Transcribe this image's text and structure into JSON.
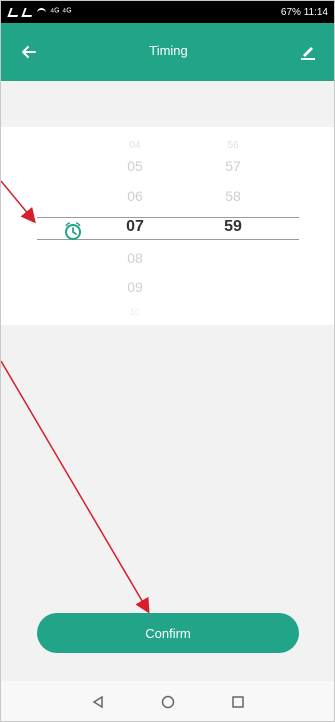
{
  "status": {
    "left": "⁴ᴳ ⁴ᴳ",
    "right": "67% 11:14"
  },
  "header": {
    "title": "Timing"
  },
  "picker": {
    "hour": {
      "upper_far": "04",
      "upper_2": "05",
      "upper_1": "06",
      "selected": "07",
      "lower_1": "08",
      "lower_2": "09",
      "lower_far": "10"
    },
    "minute": {
      "upper_far": "56",
      "upper_2": "57",
      "upper_1": "58",
      "selected": "59"
    }
  },
  "actions": {
    "confirm_label": "Confirm"
  },
  "icons": {
    "back": "arrow-left-icon",
    "edit": "pencil-icon",
    "alarm": "alarm-clock-icon",
    "nav_back": "triangle-back-icon",
    "nav_home": "circle-home-icon",
    "nav_recent": "square-recent-icon"
  },
  "colors": {
    "primary": "#21a487",
    "annotation": "#d61f2b"
  }
}
